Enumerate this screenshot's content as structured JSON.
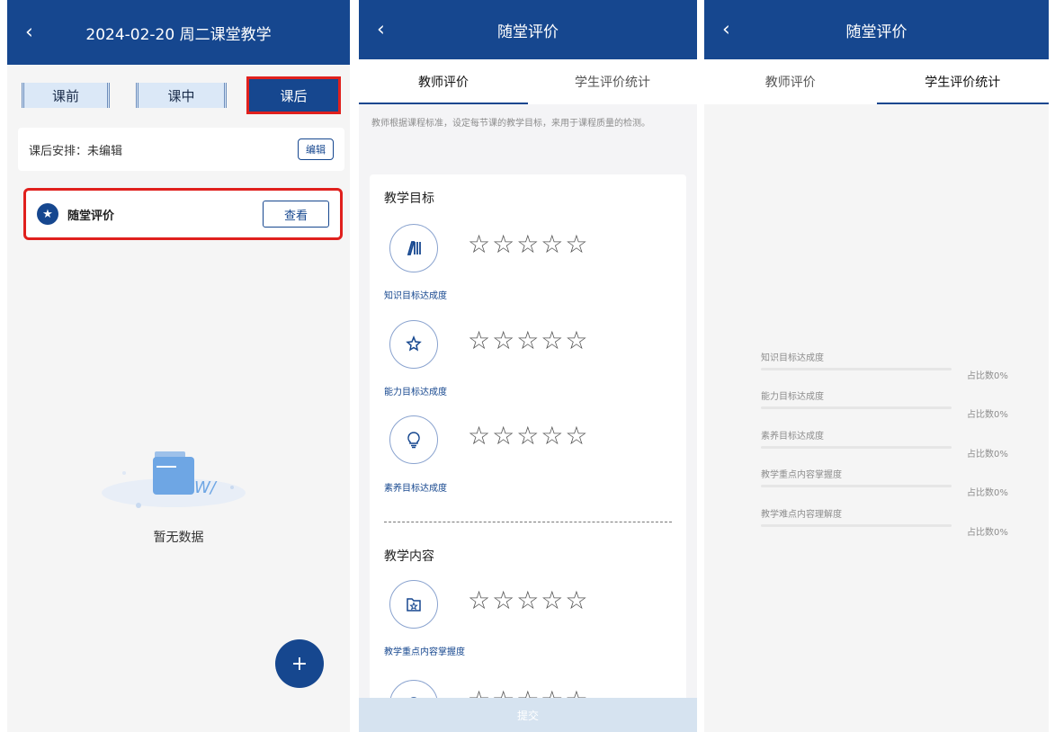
{
  "screen1": {
    "header": {
      "back_icon": "chevron-left-icon",
      "title": "2024-02-20 周二课堂教学"
    },
    "phase_tabs": [
      "课前",
      "课中",
      "课后"
    ],
    "active_phase": "课后",
    "arrange": {
      "label": "课后安排：未编辑",
      "edit_button": "编辑"
    },
    "evaluation": {
      "icon": "star-icon",
      "label": "随堂评价",
      "view_button": "查看"
    },
    "empty_text": "暂无数据",
    "fab_label": "+"
  },
  "screen2": {
    "header": {
      "title": "随堂评价"
    },
    "tabs": [
      "教师评价",
      "学生评价统计"
    ],
    "active_tab": "教师评价",
    "description": "教师根据课程标准，设定每节课的教学目标，来用于课程质量的检测。",
    "sections": [
      {
        "title": "教学目标",
        "items": [
          {
            "label": "知识目标达成度",
            "icon": "book-icon",
            "rating": 0,
            "max": 5
          },
          {
            "label": "能力目标达成度",
            "icon": "award-icon",
            "rating": 0,
            "max": 5
          },
          {
            "label": "素养目标达成度",
            "icon": "lightbulb-icon",
            "rating": 0,
            "max": 5
          }
        ]
      },
      {
        "title": "教学内容",
        "items": [
          {
            "label": "教学重点内容掌握度",
            "icon": "folder-star-icon",
            "rating": 0,
            "max": 5
          },
          {
            "label": "",
            "icon": "target-icon",
            "rating": 0,
            "max": 5
          }
        ]
      }
    ],
    "stars_text": "☆☆☆☆☆",
    "submit_label": "提交"
  },
  "screen3": {
    "header": {
      "title": "随堂评价"
    },
    "tabs": [
      "教师评价",
      "学生评价统计"
    ],
    "active_tab": "学生评价统计",
    "stats": [
      {
        "label": "知识目标达成度",
        "value_text": "占比数0%",
        "percent": 0
      },
      {
        "label": "能力目标达成度",
        "value_text": "占比数0%",
        "percent": 0
      },
      {
        "label": "素养目标达成度",
        "value_text": "占比数0%",
        "percent": 0
      },
      {
        "label": "教学重点内容掌握度",
        "value_text": "占比数0%",
        "percent": 0
      },
      {
        "label": "教学难点内容理解度",
        "value_text": "占比数0%",
        "percent": 0
      }
    ]
  },
  "colors": {
    "primary": "#16478f",
    "highlight": "#e0201d",
    "tab_light": "#dbe8f7",
    "submit_disabled": "#d6e3f0"
  }
}
